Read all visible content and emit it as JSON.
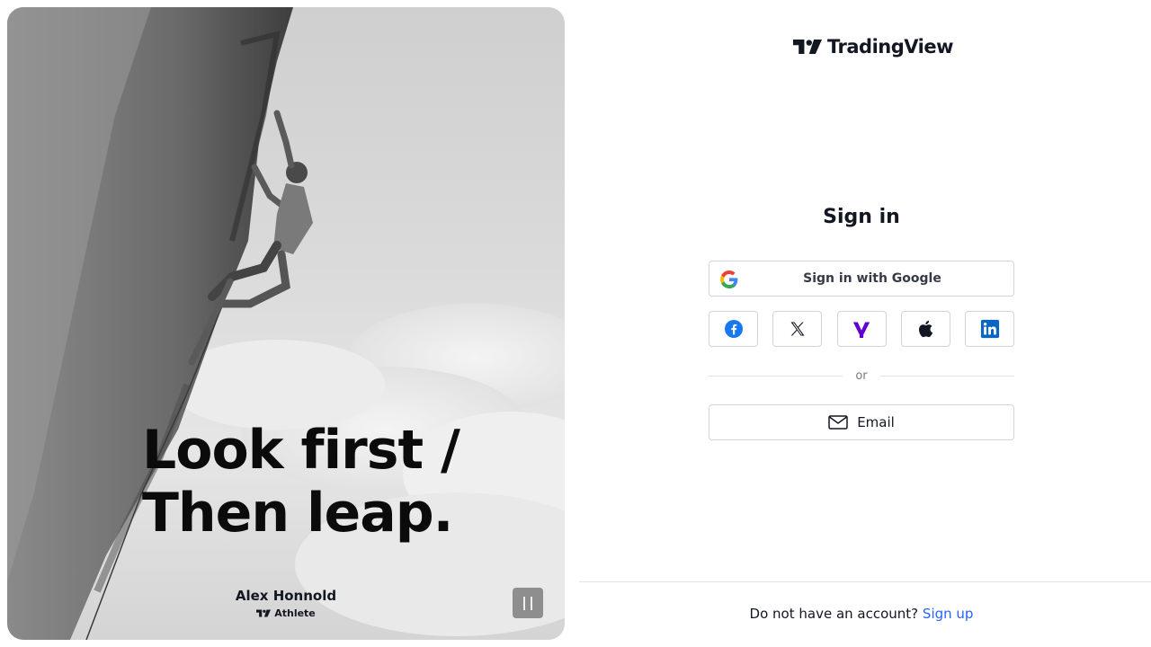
{
  "hero": {
    "headline_line1": "Look first /",
    "headline_line2": "Then leap.",
    "athlete_name": "Alex Honnold",
    "athlete_role": "Athlete"
  },
  "brand": {
    "name": "TradingView"
  },
  "signin": {
    "title": "Sign in",
    "google_label": "Sign in with Google",
    "social_buttons": [
      "facebook-icon",
      "x-icon",
      "yahoo-icon",
      "apple-icon",
      "linkedin-icon"
    ],
    "divider_text": "or",
    "email_label": "Email"
  },
  "footer": {
    "prompt": "Do not have an account?",
    "signup_link": "Sign up"
  },
  "colors": {
    "link": "#2962ff",
    "facebook": "#1877f2",
    "yahoo": "#6001d2",
    "linkedin": "#0a66c2"
  }
}
